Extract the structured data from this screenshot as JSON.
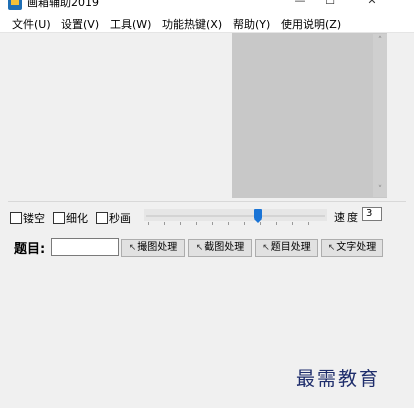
{
  "window": {
    "title": "画箱辅助2019",
    "minimize_glyph": "—",
    "maximize_glyph": "☐",
    "close_glyph": "✕"
  },
  "menu": [
    "文件(U)",
    "设置(V)",
    "工具(W)",
    "功能热键(X)",
    "帮助(Y)",
    "使用说明(Z)"
  ],
  "preview": {
    "scroll_up": "˄",
    "scroll_down": "˅"
  },
  "options": {
    "checkboxes": [
      {
        "label": "镂空",
        "checked": false
      },
      {
        "label": "细化",
        "checked": false
      },
      {
        "label": "秒画",
        "checked": false
      }
    ],
    "slider_value_fraction": 0.62,
    "speed_label": "速度",
    "speed_value": "3"
  },
  "toolbar": {
    "title_label": "题目:",
    "title_value": "",
    "buttons": [
      "撮图处理",
      "截图处理",
      "题目处理",
      "文字处理"
    ],
    "button_icon": "↖"
  },
  "watermark": "最需教育"
}
